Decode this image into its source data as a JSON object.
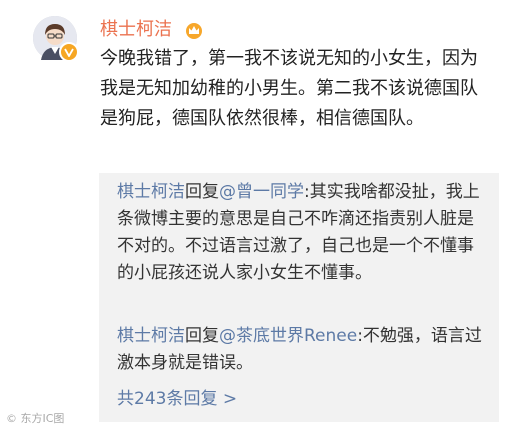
{
  "user": {
    "name": "棋士柯洁",
    "avatar_icon": "cartoon-avatar",
    "badge_icon": "verified-v-icon",
    "crown_icon": "crown-icon"
  },
  "post": {
    "text": "今晚我错了，第一我不该说无知的小女生，因为我是无知加幼稚的小男生。第二我不该说德国队是狗屁，德国队依然很棒，相信德国队。"
  },
  "replies": [
    {
      "author": "棋士柯洁",
      "reply_word": "回复",
      "mention": "@曾一同学",
      "text": ":其实我啥都没扯，我上条微博主要的意思是自己不咋滴还指责别人脏是不对的。不过语言过激了，自己也是一个不懂事的小屁孩还说人家小女生不懂事。"
    },
    {
      "author": "棋士柯洁",
      "reply_word": "回复",
      "mention": "@茶底世界Renee",
      "text": ":不勉强，语言过激本身就是错误。"
    }
  ],
  "more_replies": "共243条回复 >",
  "watermark": "© 东方IC图"
}
